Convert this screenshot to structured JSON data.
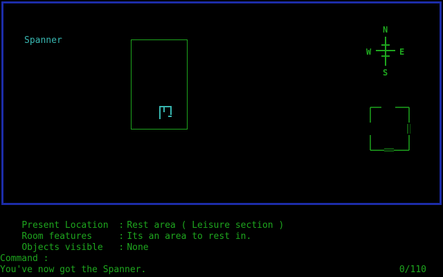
{
  "scene": {
    "item_label": "Spanner"
  },
  "compass": {
    "north": "N",
    "south": "S",
    "west": "W",
    "east": "E"
  },
  "status": {
    "present_location_key": "Present Location",
    "present_location_value": "Rest area ( Leisure section )",
    "room_features_key": "Room features",
    "room_features_value": "Its an area to rest in.",
    "objects_visible_key": "Objects visible",
    "objects_visible_value": "None",
    "separator": ":"
  },
  "command": {
    "prompt": "Command :"
  },
  "message": {
    "text": "You've now got the Spanner."
  },
  "score": {
    "text": "0/110"
  },
  "colors": {
    "text_green": "#1ea61e",
    "text_cyan": "#38b6b0",
    "frame_blue": "#1c2ca8",
    "background": "#000000"
  }
}
